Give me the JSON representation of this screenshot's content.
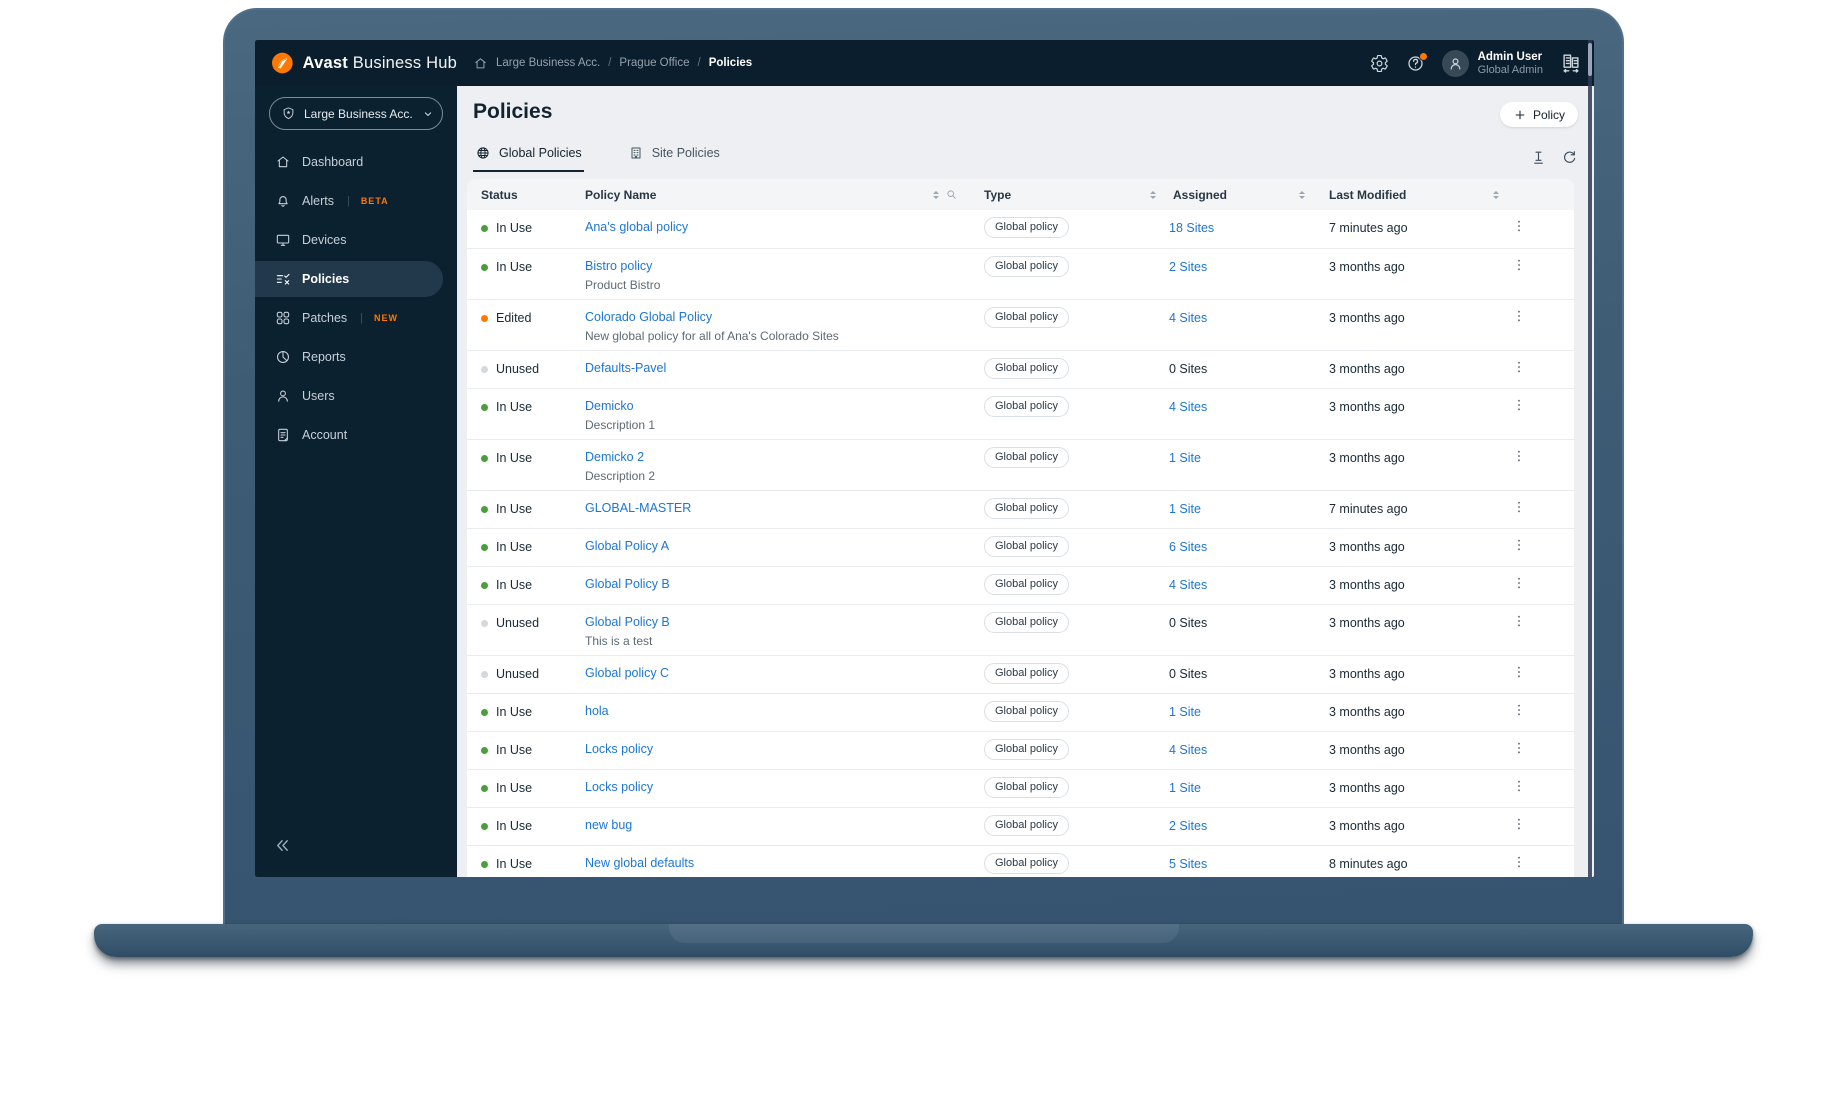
{
  "colors": {
    "accent_orange": "#FF7800",
    "link_blue": "#1D76D2",
    "status_in_use_green": "#4B9E3C",
    "status_edited_orange": "#FF7800",
    "status_unused_gray": "#D4D9DD",
    "topbar_bg": "#0A1E2D",
    "sidebar_bg": "#0B2130",
    "content_bg": "#EDEFF2",
    "laptop_bezel": "#3E5C74"
  },
  "topbar": {
    "logo_icon": "avast-logo-icon",
    "brand_bold": "Avast",
    "brand_light": "Business Hub",
    "breadcrumb": {
      "home_icon": "home-icon",
      "separator": "/",
      "items": [
        "Large Business Acc.",
        "Prague Office",
        "Policies"
      ]
    },
    "icons": {
      "settings": "gear-icon",
      "help": "help-icon",
      "org_switcher": "buildings-switch-icon"
    },
    "user": {
      "name": "Admin User",
      "role": "Global Admin",
      "avatar_icon": "person-icon"
    }
  },
  "sidebar": {
    "account_selector": {
      "label": "Large Business Acc.",
      "icon": "shield-star-icon",
      "chevron_icon": "chevron-down-icon"
    },
    "items": [
      {
        "label": "Dashboard",
        "icon": "home-icon",
        "active": false,
        "badge": null
      },
      {
        "label": "Alerts",
        "icon": "bell-icon",
        "active": false,
        "badge": "BETA"
      },
      {
        "label": "Devices",
        "icon": "monitor-icon",
        "active": false,
        "badge": null
      },
      {
        "label": "Policies",
        "icon": "checklist-icon",
        "active": true,
        "badge": null
      },
      {
        "label": "Patches",
        "icon": "patches-icon",
        "active": false,
        "badge": "NEW"
      },
      {
        "label": "Reports",
        "icon": "pie-chart-icon",
        "active": false,
        "badge": null
      },
      {
        "label": "Users",
        "icon": "user-icon",
        "active": false,
        "badge": null
      },
      {
        "label": "Account",
        "icon": "account-doc-icon",
        "active": false,
        "badge": null
      }
    ],
    "collapse_icon": "double-chevron-left-icon",
    "collapse_glyph": "«"
  },
  "main": {
    "title": "Policies",
    "add_button": {
      "icon": "plus-icon",
      "label": "Policy"
    },
    "tabs": [
      {
        "label": "Global Policies",
        "icon": "globe-icon",
        "active": true
      },
      {
        "label": "Site Policies",
        "icon": "building-icon",
        "active": false
      }
    ],
    "toolbar_icons": {
      "column_tool": "text-cursor-icon",
      "refresh": "refresh-icon"
    }
  },
  "table": {
    "headers": [
      {
        "label": "Status",
        "sortable": false,
        "search": false
      },
      {
        "label": "Policy Name",
        "sortable": true,
        "search": true
      },
      {
        "label": "Type",
        "sortable": true,
        "search": false
      },
      {
        "label": "Assigned",
        "sortable": true,
        "search": false
      },
      {
        "label": "Last Modified",
        "sortable": true,
        "search": false
      }
    ],
    "row_action_icon": "kebab-menu-icon",
    "rows": [
      {
        "status": "In Use",
        "status_type": "in-use",
        "name": "Ana's global policy",
        "description": null,
        "type": "Global policy",
        "assigned": "18 Sites",
        "assigned_link": true,
        "modified": "7 minutes ago"
      },
      {
        "status": "In Use",
        "status_type": "in-use",
        "name": "Bistro policy",
        "description": "Product Bistro",
        "type": "Global policy",
        "assigned": "2 Sites",
        "assigned_link": true,
        "modified": "3 months ago"
      },
      {
        "status": "Edited",
        "status_type": "edited",
        "name": "Colorado Global Policy",
        "description": "New global policy for all of Ana's Colorado Sites",
        "type": "Global policy",
        "assigned": "4 Sites",
        "assigned_link": true,
        "modified": "3 months ago"
      },
      {
        "status": "Unused",
        "status_type": "unused",
        "name": "Defaults-Pavel",
        "description": null,
        "type": "Global policy",
        "assigned": "0 Sites",
        "assigned_link": false,
        "modified": "3 months ago"
      },
      {
        "status": "In Use",
        "status_type": "in-use",
        "name": "Demicko",
        "description": "Description 1",
        "type": "Global policy",
        "assigned": "4 Sites",
        "assigned_link": true,
        "modified": "3 months ago"
      },
      {
        "status": "In Use",
        "status_type": "in-use",
        "name": "Demicko 2",
        "description": "Description 2",
        "type": "Global policy",
        "assigned": "1 Site",
        "assigned_link": true,
        "modified": "3 months ago"
      },
      {
        "status": "In Use",
        "status_type": "in-use",
        "name": "GLOBAL-MASTER",
        "description": null,
        "type": "Global policy",
        "assigned": "1 Site",
        "assigned_link": true,
        "modified": "7 minutes ago"
      },
      {
        "status": "In Use",
        "status_type": "in-use",
        "name": "Global Policy A",
        "description": null,
        "type": "Global policy",
        "assigned": "6 Sites",
        "assigned_link": true,
        "modified": "3 months ago"
      },
      {
        "status": "In Use",
        "status_type": "in-use",
        "name": "Global Policy B",
        "description": null,
        "type": "Global policy",
        "assigned": "4 Sites",
        "assigned_link": true,
        "modified": "3 months ago"
      },
      {
        "status": "Unused",
        "status_type": "unused",
        "name": "Global Policy B",
        "description": "This is a test",
        "type": "Global policy",
        "assigned": "0 Sites",
        "assigned_link": false,
        "modified": "3 months ago"
      },
      {
        "status": "Unused",
        "status_type": "unused",
        "name": "Global policy C",
        "description": null,
        "type": "Global policy",
        "assigned": "0 Sites",
        "assigned_link": false,
        "modified": "3 months ago"
      },
      {
        "status": "In Use",
        "status_type": "in-use",
        "name": "hola",
        "description": null,
        "type": "Global policy",
        "assigned": "1 Site",
        "assigned_link": true,
        "modified": "3 months ago"
      },
      {
        "status": "In Use",
        "status_type": "in-use",
        "name": "Locks policy",
        "description": null,
        "type": "Global policy",
        "assigned": "4 Sites",
        "assigned_link": true,
        "modified": "3 months ago"
      },
      {
        "status": "In Use",
        "status_type": "in-use",
        "name": "Locks policy",
        "description": null,
        "type": "Global policy",
        "assigned": "1 Site",
        "assigned_link": true,
        "modified": "3 months ago"
      },
      {
        "status": "In Use",
        "status_type": "in-use",
        "name": "new bug",
        "description": null,
        "type": "Global policy",
        "assigned": "2 Sites",
        "assigned_link": true,
        "modified": "3 months ago"
      },
      {
        "status": "In Use",
        "status_type": "in-use",
        "name": "New global defaults",
        "description": null,
        "type": "Global policy",
        "assigned": "5 Sites",
        "assigned_link": true,
        "modified": "8 minutes ago"
      }
    ]
  }
}
